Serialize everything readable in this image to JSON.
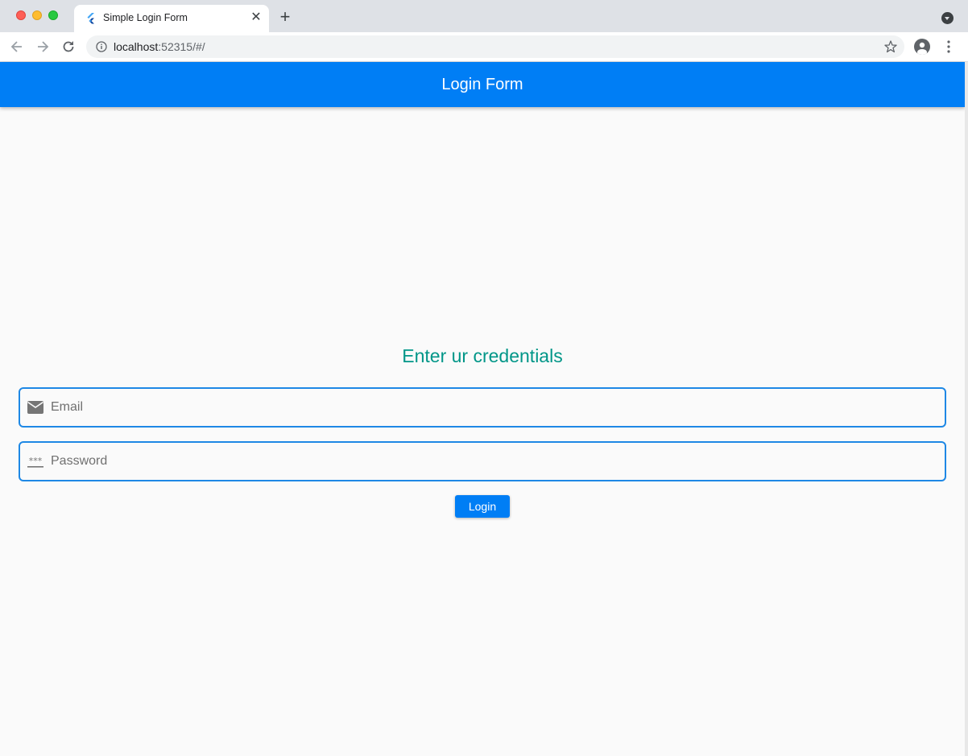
{
  "browser": {
    "tab_title": "Simple Login Form",
    "tab_close": "✕",
    "new_tab": "+",
    "url_host": "localhost",
    "url_rest": ":52315/#/",
    "icons": [
      "flutter-favicon",
      "close-icon",
      "plus-icon",
      "tab-search-icon",
      "back-arrow-icon",
      "forward-arrow-icon",
      "reload-icon",
      "info-icon",
      "star-icon",
      "profile-icon",
      "kebab-menu-icon"
    ]
  },
  "app": {
    "title": "Login Form",
    "heading": "Enter ur credentials",
    "email_placeholder": "Email",
    "password_placeholder": "Password",
    "login_label": "Login",
    "colors": {
      "appbar": "#007ef5",
      "heading": "#009688",
      "field_border": "#1e88e5",
      "button": "#007ef5",
      "background": "#fafafa"
    }
  }
}
